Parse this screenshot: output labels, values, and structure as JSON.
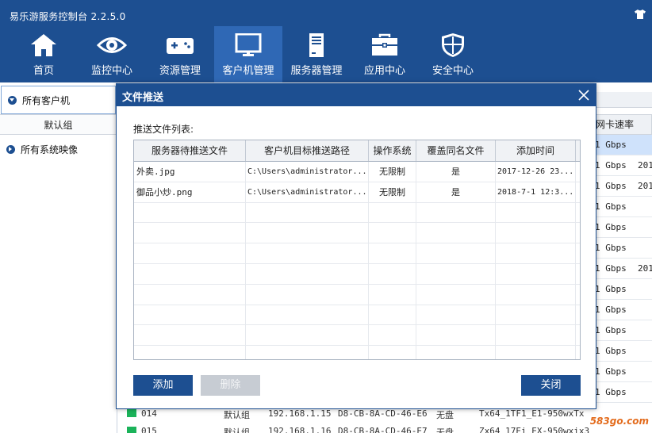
{
  "app": {
    "title": "易乐游服务控制台 2.2.5.0"
  },
  "nav": [
    {
      "label": "首页",
      "icon": "home-icon"
    },
    {
      "label": "监控中心",
      "icon": "eye-icon"
    },
    {
      "label": "资源管理",
      "icon": "gamepad-icon"
    },
    {
      "label": "客户机管理",
      "icon": "monitor-icon",
      "active": true
    },
    {
      "label": "服务器管理",
      "icon": "server-icon"
    },
    {
      "label": "应用中心",
      "icon": "toolbox-icon"
    },
    {
      "label": "安全中心",
      "icon": "shield-icon"
    }
  ],
  "sidebar": {
    "items": [
      {
        "label": "所有客户机"
      },
      {
        "label": "默认组"
      },
      {
        "label": "所有系统映像"
      }
    ]
  },
  "background_table": {
    "header_partial": "网卡速率",
    "rows": [
      {
        "c1": "1 Gbps",
        "c2": ""
      },
      {
        "c1": "1 Gbps",
        "c2": "201"
      },
      {
        "c1": "1 Gbps",
        "c2": "201"
      },
      {
        "c1": "1 Gbps",
        "c2": ""
      },
      {
        "c1": "1 Gbps",
        "c2": ""
      },
      {
        "c1": "1 Gbps",
        "c2": ""
      },
      {
        "c1": "1 Gbps",
        "c2": "201"
      },
      {
        "c1": "1 Gbps",
        "c2": ""
      },
      {
        "c1": "1 Gbps",
        "c2": ""
      },
      {
        "c1": "1 Gbps",
        "c2": ""
      },
      {
        "c1": "1 Gbps",
        "c2": ""
      },
      {
        "c1": "1 Gbps",
        "c2": ""
      },
      {
        "c1": "1 Gbps",
        "c2": ""
      }
    ],
    "bottom_rows": [
      {
        "id": "014",
        "group": "默认组",
        "ip": "192.168.1.15",
        "mac": "D8-CB-8A-CD-46-E6",
        "disk": "无盘",
        "os": "Tx64_1TF1_E1-950wxTx"
      },
      {
        "id": "015",
        "group": "默认组",
        "ip": "192.168.1.16",
        "mac": "D8-CB-8A-CD-46-E7",
        "disk": "无盘",
        "os": "Zx64_17Ei_EX-950wxix3"
      }
    ]
  },
  "modal": {
    "title": "文件推送",
    "list_label": "推送文件列表:",
    "columns": [
      "服务器待推送文件",
      "客户机目标推送路径",
      "操作系统",
      "覆盖同名文件",
      "添加时间"
    ],
    "rows": [
      [
        "外卖.jpg",
        "C:\\Users\\administrator...",
        "无限制",
        "是",
        "2017-12-26 23..."
      ],
      [
        "御品小炒.png",
        "C:\\Users\\administrator...",
        "无限制",
        "是",
        "2018-7-1 12:3..."
      ],
      [
        "",
        "",
        "",
        "",
        ""
      ],
      [
        "",
        "",
        "",
        "",
        ""
      ],
      [
        "",
        "",
        "",
        "",
        ""
      ],
      [
        "",
        "",
        "",
        "",
        ""
      ],
      [
        "",
        "",
        "",
        "",
        ""
      ],
      [
        "",
        "",
        "",
        "",
        ""
      ],
      [
        "",
        "",
        "",
        "",
        ""
      ],
      [
        "",
        "",
        "",
        "",
        ""
      ]
    ],
    "buttons": {
      "add": "添加",
      "delete": "删除",
      "close": "关闭"
    }
  },
  "watermark": "583go.com",
  "colors": {
    "header_bg": "#1d4f91",
    "nav_active": "#2f68b5",
    "row_highlight": "#cfe2fb",
    "button_disabled": "#c7ccd3"
  }
}
